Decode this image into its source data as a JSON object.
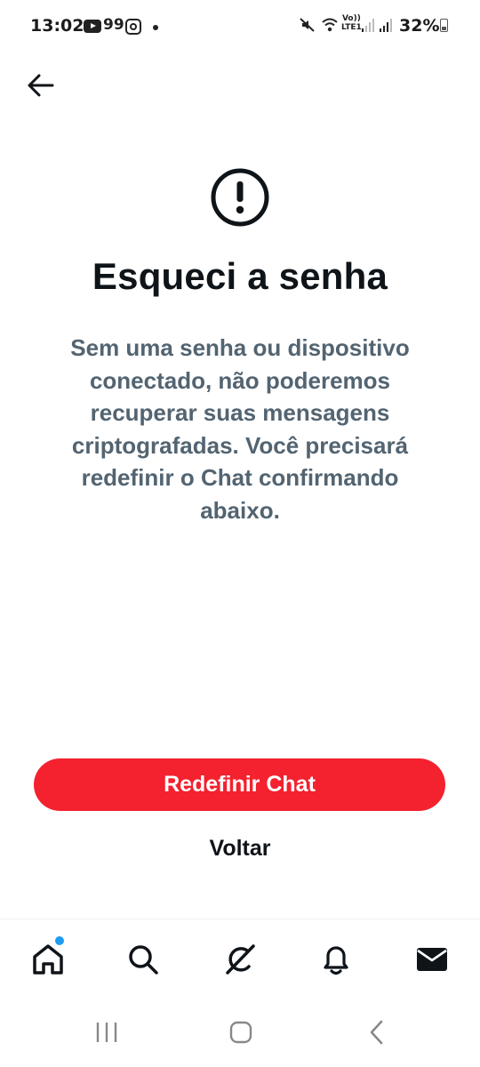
{
  "status_bar": {
    "time": "13:02",
    "notif_count": "99",
    "volte_label_top": "Vo))",
    "volte_label_bottom": "LTE1",
    "battery_percent": "32%"
  },
  "icons": {
    "back": "arrow-left-icon",
    "alert": "exclamation-circle-icon",
    "home": "home-icon",
    "search": "search-icon",
    "grok": "grok-icon",
    "notifications": "bell-icon",
    "messages": "envelope-icon"
  },
  "main": {
    "title": "Esqueci a senha",
    "description_lines": [
      "Sem uma senha ou dispositivo",
      "conectado, não poderemos",
      "recuperar suas mensagens",
      "criptografadas. Você precisará",
      "redefinir o Chat confirmando",
      "abaixo."
    ],
    "primary_button": "Redefinir Chat",
    "secondary_button": "Voltar"
  },
  "colors": {
    "primary_button_bg": "#f4212e",
    "description_text": "#536471",
    "badge": "#1d9bf0"
  }
}
